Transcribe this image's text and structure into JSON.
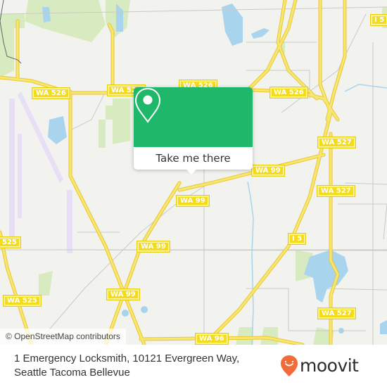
{
  "map": {
    "attribution": "© OpenStreetMap contributors",
    "road_shields": [
      {
        "label": "WA 526",
        "id": "wa526-west"
      },
      {
        "label": "WA 526",
        "id": "wa526-center"
      },
      {
        "label": "WA 526",
        "id": "wa526-east"
      },
      {
        "label": "I 5",
        "id": "i5-north"
      },
      {
        "label": "WA 527",
        "id": "wa527-north"
      },
      {
        "label": "WA 99",
        "id": "wa99-popup"
      },
      {
        "label": "WA 99",
        "id": "wa99-center"
      },
      {
        "label": "WA 527",
        "id": "wa527-mid"
      },
      {
        "label": "I 5",
        "id": "i5-mid"
      },
      {
        "label": "WA 99",
        "id": "wa99-west"
      },
      {
        "label": "WA 99",
        "id": "wa99-south"
      },
      {
        "label": "WA 525",
        "id": "wa525-south"
      },
      {
        "label": "525",
        "id": "wa525-edge"
      },
      {
        "label": "WA 527",
        "id": "wa527-south"
      },
      {
        "label": "WA 96",
        "id": "wa96"
      }
    ],
    "colors": {
      "land": "#f2f2ef",
      "water": "#a9d4ee",
      "park": "#d8ebc0",
      "highway": "#f5df55",
      "runway": "#e6dff5",
      "popup_green": "#1fb86a"
    }
  },
  "popup": {
    "icon": "map-pin-icon",
    "cta_label": "Take me there"
  },
  "footer": {
    "address_line1": "1 Emergency Locksmith, 10121 Evergreen Way,",
    "address_line2": "Seattle Tacoma Bellevue",
    "logo_text": "moovit",
    "logo_icon": "moovit-smile-pin-icon",
    "logo_color": "#f26b3a"
  }
}
